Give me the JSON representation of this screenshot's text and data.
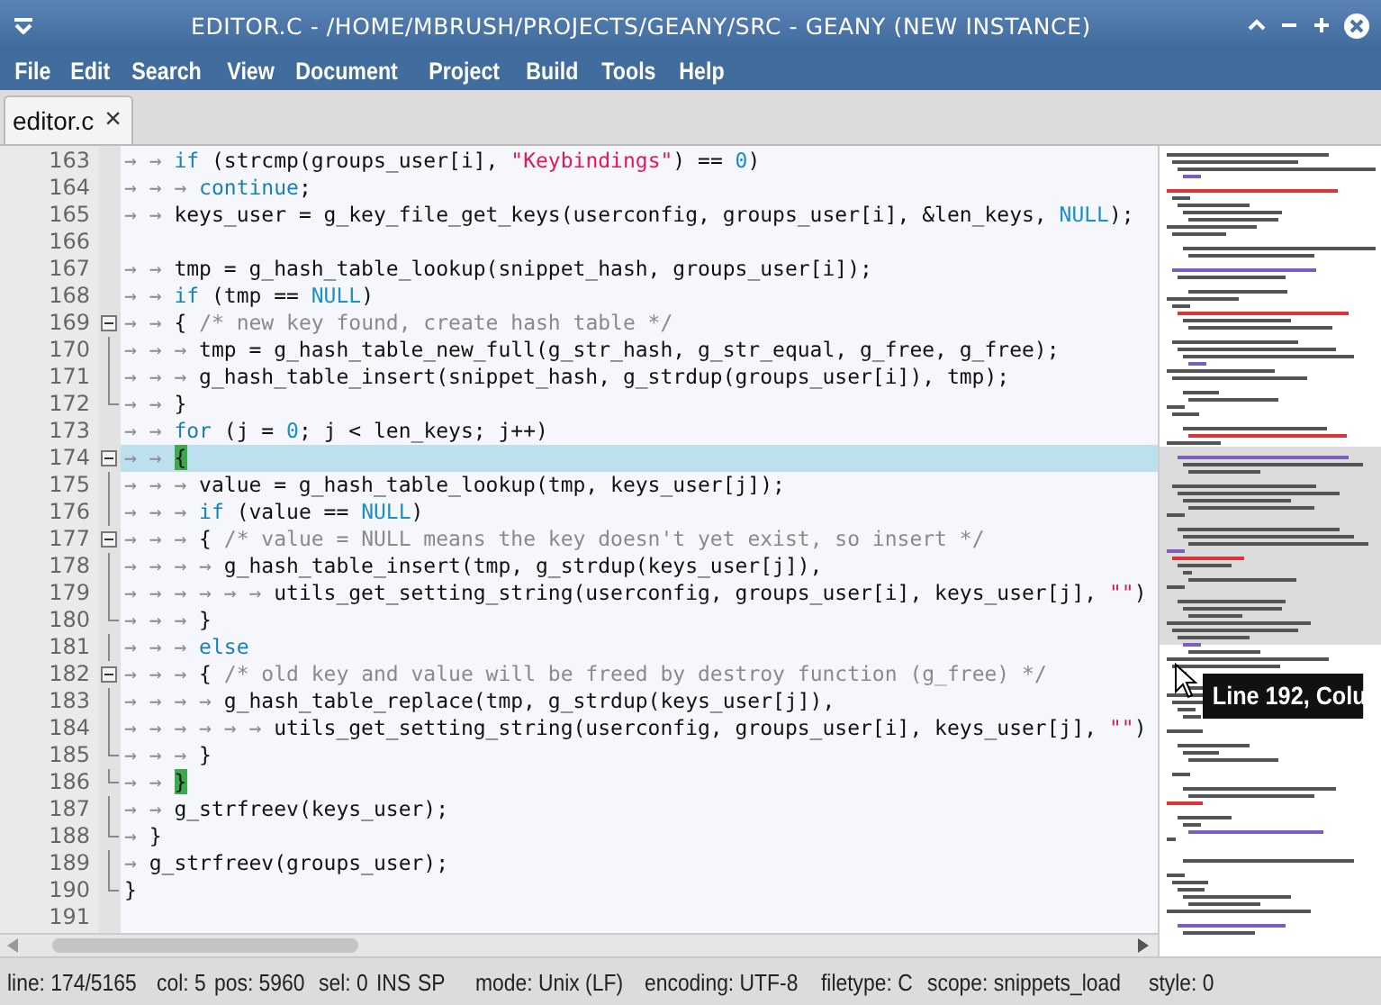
{
  "window": {
    "title": "EDITOR.C - /HOME/MBRUSH/PROJECTS/GEANY/SRC - GEANY (NEW INSTANCE)"
  },
  "menu": [
    "File",
    "Edit",
    "Search",
    "View",
    "Document",
    "Project",
    "Build",
    "Tools",
    "Help"
  ],
  "tabs": [
    {
      "label": "editor.c",
      "selected": true,
      "close": "×"
    }
  ],
  "editor": {
    "lines": [
      {
        "number": "163",
        "indent": "→→",
        "kind": "plain",
        "current": false,
        "tokens": [
          {
            "kind": "keyword",
            "text": "if"
          },
          {
            "kind": "plain",
            "text": " (strcmp(groups_user[i], "
          },
          {
            "kind": "string",
            "text": "\"Keybindings\""
          },
          {
            "kind": "plain",
            "text": ") == "
          },
          {
            "kind": "constant",
            "text": "0"
          },
          {
            "kind": "plain",
            "text": ")"
          }
        ]
      },
      {
        "number": "164",
        "indent": "→→→",
        "kind": "plain",
        "current": false,
        "tokens": [
          {
            "kind": "keyword",
            "text": "continue"
          },
          {
            "kind": "plain",
            "text": ";"
          }
        ]
      },
      {
        "number": "165",
        "indent": "→→",
        "kind": "plain",
        "current": false,
        "tokens": [
          {
            "kind": "plain",
            "text": "keys_user = g_key_file_get_keys(userconfig, groups_user[i], &len_keys, "
          },
          {
            "kind": "constant",
            "text": "NULL"
          },
          {
            "kind": "plain",
            "text": ");"
          }
        ]
      },
      {
        "number": "166",
        "kind": "plain",
        "current": false
      },
      {
        "number": "167",
        "indent": "→→",
        "kind": "plain",
        "current": false,
        "tokens": [
          {
            "kind": "plain",
            "text": "tmp = g_hash_table_lookup(snippet_hash, groups_user[i]);"
          }
        ]
      },
      {
        "number": "168",
        "indent": "→→",
        "kind": "plain",
        "current": false,
        "tokens": [
          {
            "kind": "keyword",
            "text": "if"
          },
          {
            "kind": "plain",
            "text": " (tmp == "
          },
          {
            "kind": "constant",
            "text": "NULL"
          },
          {
            "kind": "plain",
            "text": ")"
          }
        ]
      },
      {
        "number": "169",
        "indent": "→→",
        "kind": "fold-start",
        "current": false,
        "tokens": [
          {
            "kind": "plain",
            "text": "{ "
          },
          {
            "kind": "comment",
            "text": "/* new key found, create hash table */"
          }
        ]
      },
      {
        "number": "170",
        "indent": "→→→",
        "kind": "fold-body",
        "current": false,
        "tokens": [
          {
            "kind": "plain",
            "text": "tmp = g_hash_table_new_full(g_str_hash, g_str_equal, g_free, g_free);"
          }
        ]
      },
      {
        "number": "171",
        "indent": "→→→",
        "kind": "fold-body",
        "current": false,
        "tokens": [
          {
            "kind": "plain",
            "text": "g_hash_table_insert(snippet_hash, g_strdup(groups_user[i]), tmp);"
          }
        ]
      },
      {
        "number": "172",
        "indent": "→→",
        "kind": "fold-end",
        "current": false,
        "tokens": [
          {
            "kind": "plain",
            "text": "}"
          }
        ]
      },
      {
        "number": "173",
        "indent": "→→",
        "kind": "plain",
        "current": false,
        "tokens": [
          {
            "kind": "keyword",
            "text": "for"
          },
          {
            "kind": "plain",
            "text": " (j = "
          },
          {
            "kind": "constant",
            "text": "0"
          },
          {
            "kind": "plain",
            "text": "; j < len_keys; j++)"
          }
        ]
      },
      {
        "number": "174",
        "indent": "→→",
        "kind": "fold-start",
        "current": true,
        "tokens": [
          {
            "kind": "brace",
            "text": "{"
          }
        ]
      },
      {
        "number": "175",
        "indent": "→→→",
        "kind": "fold-body",
        "current": false,
        "tokens": [
          {
            "kind": "plain",
            "text": "value = g_hash_table_lookup(tmp, keys_user[j]);"
          }
        ]
      },
      {
        "number": "176",
        "indent": "→→→",
        "kind": "fold-body",
        "current": false,
        "tokens": [
          {
            "kind": "keyword",
            "text": "if"
          },
          {
            "kind": "plain",
            "text": " (value == "
          },
          {
            "kind": "constant",
            "text": "NULL"
          },
          {
            "kind": "plain",
            "text": ")"
          }
        ]
      },
      {
        "number": "177",
        "indent": "→→→",
        "kind": "fold-start",
        "current": false,
        "tokens": [
          {
            "kind": "plain",
            "text": "{ "
          },
          {
            "kind": "comment",
            "text": "/* value = NULL means the key doesn't yet exist, so insert */"
          }
        ]
      },
      {
        "number": "178",
        "indent": "→→→→",
        "kind": "fold-body",
        "current": false,
        "tokens": [
          {
            "kind": "plain",
            "text": "g_hash_table_insert(tmp, g_strdup(keys_user[j]),"
          }
        ]
      },
      {
        "number": "179",
        "indent": "→→→→→→",
        "kind": "fold-body",
        "current": false,
        "tokens": [
          {
            "kind": "plain",
            "text": "utils_get_setting_string(userconfig, groups_user[i], keys_user[j], "
          },
          {
            "kind": "string",
            "text": "\"\""
          },
          {
            "kind": "plain",
            "text": ")"
          }
        ]
      },
      {
        "number": "180",
        "indent": "→→→",
        "kind": "fold-end",
        "current": false,
        "tokens": [
          {
            "kind": "plain",
            "text": "}"
          }
        ]
      },
      {
        "number": "181",
        "indent": "→→→",
        "kind": "fold-body",
        "current": false,
        "tokens": [
          {
            "kind": "keyword",
            "text": "else"
          }
        ]
      },
      {
        "number": "182",
        "indent": "→→→",
        "kind": "fold-start",
        "current": false,
        "tokens": [
          {
            "kind": "plain",
            "text": "{ "
          },
          {
            "kind": "comment",
            "text": "/* old key and value will be freed by destroy function (g_free) */"
          }
        ]
      },
      {
        "number": "183",
        "indent": "→→→→",
        "kind": "fold-body",
        "current": false,
        "tokens": [
          {
            "kind": "plain",
            "text": "g_hash_table_replace(tmp, g_strdup(keys_user[j]),"
          }
        ]
      },
      {
        "number": "184",
        "indent": "→→→→→→",
        "kind": "fold-body",
        "current": false,
        "tokens": [
          {
            "kind": "plain",
            "text": "utils_get_setting_string(userconfig, groups_user[i], keys_user[j], "
          },
          {
            "kind": "string",
            "text": "\"\""
          },
          {
            "kind": "plain",
            "text": ")"
          }
        ]
      },
      {
        "number": "185",
        "indent": "→→→",
        "kind": "fold-end",
        "current": false,
        "tokens": [
          {
            "kind": "plain",
            "text": "}"
          }
        ]
      },
      {
        "number": "186",
        "indent": "→→",
        "kind": "fold-end",
        "current": false,
        "tokens": [
          {
            "kind": "brace",
            "text": "}"
          }
        ]
      },
      {
        "number": "187",
        "indent": "→→",
        "kind": "fold-body",
        "current": false,
        "tokens": [
          {
            "kind": "plain",
            "text": "g_strfreev(keys_user);"
          }
        ]
      },
      {
        "number": "188",
        "indent": "→",
        "kind": "fold-end",
        "current": false,
        "tokens": [
          {
            "kind": "plain",
            "text": "}"
          }
        ]
      },
      {
        "number": "189",
        "indent": "→",
        "kind": "fold-body",
        "current": false,
        "tokens": [
          {
            "kind": "plain",
            "text": "g_strfreev(groups_user);"
          }
        ]
      },
      {
        "number": "190",
        "kind": "fold-end",
        "current": false,
        "tokens": [
          {
            "kind": "plain",
            "text": "}"
          }
        ]
      },
      {
        "number": "191",
        "kind": "plain",
        "current": false
      }
    ],
    "tooltip": "Line 192, Colu"
  },
  "status_bar": [
    "line: 174/5165",
    "col: 5",
    "pos: 5960",
    "sel: 0",
    "INS",
    "SP",
    "mode: Unix (LF)",
    "encoding: UTF-8",
    "filetype: C",
    "scope: snippets_load",
    "style: 0"
  ]
}
